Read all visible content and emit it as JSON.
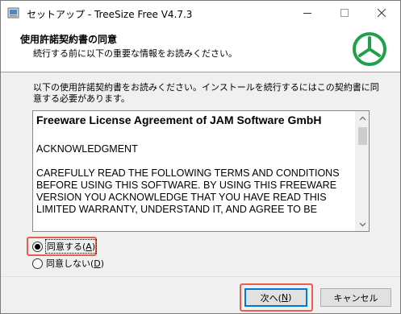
{
  "window": {
    "title": "セットアップ - TreeSize Free V4.7.3"
  },
  "header": {
    "title": "使用許諾契約書の同意",
    "subtitle": "続行する前に以下の重要な情報をお読みください。"
  },
  "content": {
    "instruction": "以下の使用許諾契約書をお読みください。インストールを続行するにはこの契約書に同意する必要があります。",
    "license": {
      "heading": "Freeware License Agreement of JAM Software GmbH",
      "acknowledgment": "ACKNOWLEDGMENT",
      "body": "CAREFULLY READ THE FOLLOWING TERMS AND CONDITIONS BEFORE USING THIS SOFTWARE. BY USING THIS FREEWARE VERSION YOU ACKNOWLEDGE THAT YOU HAVE READ THIS LIMITED WARRANTY, UNDERSTAND IT, AND AGREE TO BE"
    }
  },
  "options": {
    "accept_label": "同意する(",
    "accept_key": "A",
    "accept_suffix": ")",
    "decline_label": "同意しない(",
    "decline_key": "D",
    "decline_suffix": ")",
    "selected": "accept"
  },
  "buttons": {
    "next_label": "次へ(",
    "next_key": "N",
    "next_suffix": ")",
    "cancel_label": "キャンセル"
  },
  "colors": {
    "logo_green": "#1ea14a",
    "highlight_red": "#e8604c",
    "focus_blue": "#0078d7"
  },
  "icons": {
    "app": "installer-app-icon",
    "logo": "treesize-logo-icon",
    "minimize": "minimize-icon",
    "maximize": "maximize-icon",
    "close": "close-icon"
  }
}
